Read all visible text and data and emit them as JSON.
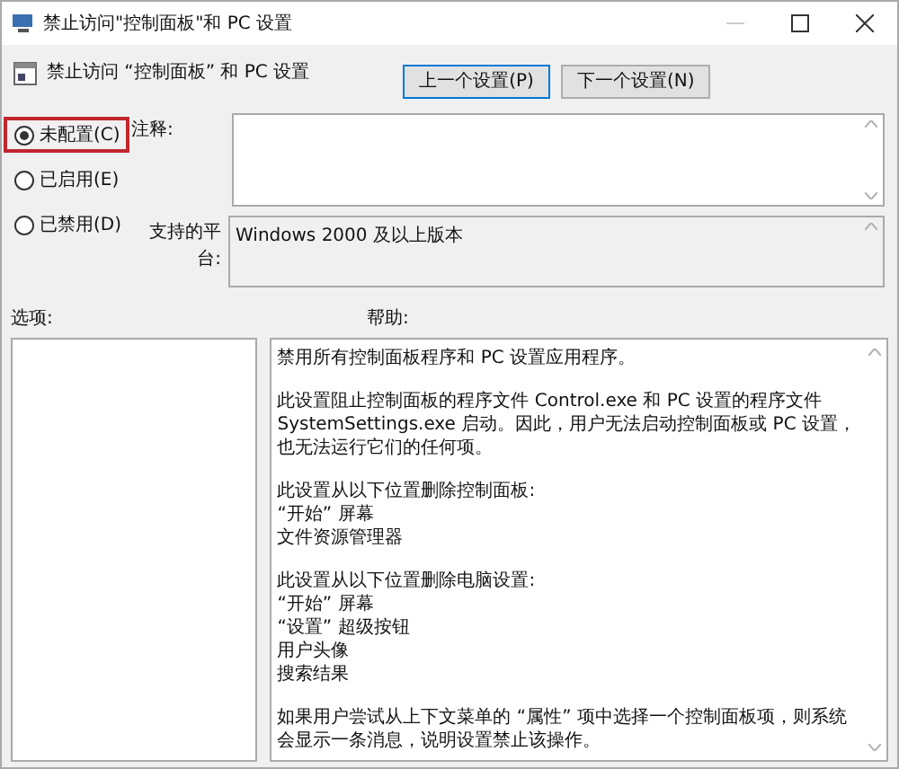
{
  "window": {
    "title": "禁止访问\"控制面板\"和 PC 设置"
  },
  "policy_name": "禁止访问 “控制面板” 和 PC 设置",
  "nav_buttons": [
    {
      "label": "上一个设置(P)",
      "focused": true
    },
    {
      "label": "下一个设置(N)",
      "focused": false
    }
  ],
  "options": [
    {
      "label": "未配置(C)",
      "selected": true,
      "highlighted": true
    },
    {
      "label": "已启用(E)",
      "selected": false,
      "highlighted": false
    },
    {
      "label": "已禁用(D)",
      "selected": false,
      "highlighted": false
    }
  ],
  "comment": {
    "label": "注释:"
  },
  "platform": {
    "label": "支持的平台:",
    "value": "Windows 2000 及以上版本"
  },
  "options_pane": {
    "label": "选项:"
  },
  "help_pane": {
    "label": "帮助:",
    "paragraphs": [
      [
        "禁用所有控制面板程序和 PC 设置应用程序。"
      ],
      [
        "此设置阻止控制面板的程序文件 Control.exe 和 PC 设置的程序文件",
        "SystemSettings.exe 启动。因此，用户无法启动控制面板或 PC 设置，",
        "也无法运行它们的任何项。"
      ],
      [
        "此设置从以下位置删除控制面板:",
        "“开始” 屏幕",
        "文件资源管理器"
      ],
      [
        "此设置从以下位置删除电脑设置:",
        "“开始” 屏幕",
        "“设置” 超级按钮",
        "用户头像",
        "搜索结果"
      ],
      [
        "如果用户尝试从上下文菜单的 “属性” 项中选择一个控制面板项，则系统",
        "会显示一条消息，说明设置禁止该操作。"
      ]
    ]
  }
}
